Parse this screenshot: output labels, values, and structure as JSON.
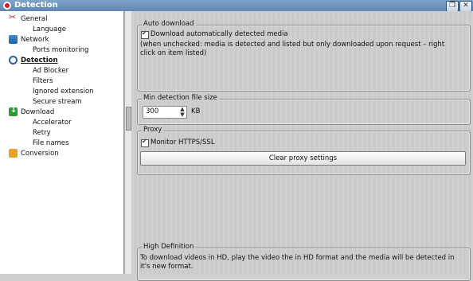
{
  "window": {
    "title": "Detection"
  },
  "sidebar": {
    "items": [
      {
        "label": "General",
        "level": 0,
        "icon": "scissors-icon"
      },
      {
        "label": "Language",
        "level": 1
      },
      {
        "label": "Network",
        "level": 0,
        "icon": "network-icon"
      },
      {
        "label": "Ports monitoring",
        "level": 1
      },
      {
        "label": "Detection",
        "level": 0,
        "icon": "magnifier-icon",
        "selected": true
      },
      {
        "label": "Ad Blocker",
        "level": 1
      },
      {
        "label": "Filters",
        "level": 1
      },
      {
        "label": "Ignored extension",
        "level": 1
      },
      {
        "label": "Secure stream",
        "level": 1
      },
      {
        "label": "Download",
        "level": 0,
        "icon": "download-icon"
      },
      {
        "label": "Accelerator",
        "level": 1
      },
      {
        "label": "Retry",
        "level": 1
      },
      {
        "label": "File names",
        "level": 1
      },
      {
        "label": "Conversion",
        "level": 0,
        "icon": "conversion-icon"
      }
    ]
  },
  "auto_download": {
    "title": "Auto download",
    "checkbox_label": "Download automatically detected media",
    "checked": true,
    "note": "(when unchecked: media is detected and listed but only downloaded upon request – right click on item listed)"
  },
  "min_size": {
    "title": "Min detection file size",
    "value": "300",
    "unit": "KB"
  },
  "proxy": {
    "title": "Proxy",
    "checkbox_label": "Monitor HTTPS/SSL",
    "checked": true,
    "button_label": "Clear proxy settings"
  },
  "hd": {
    "title": "High Definition",
    "text": "To download videos in HD, play the video the in HD format and the media will be detected in it's new format."
  },
  "controls": {
    "restore": "❐",
    "close": "✕"
  }
}
